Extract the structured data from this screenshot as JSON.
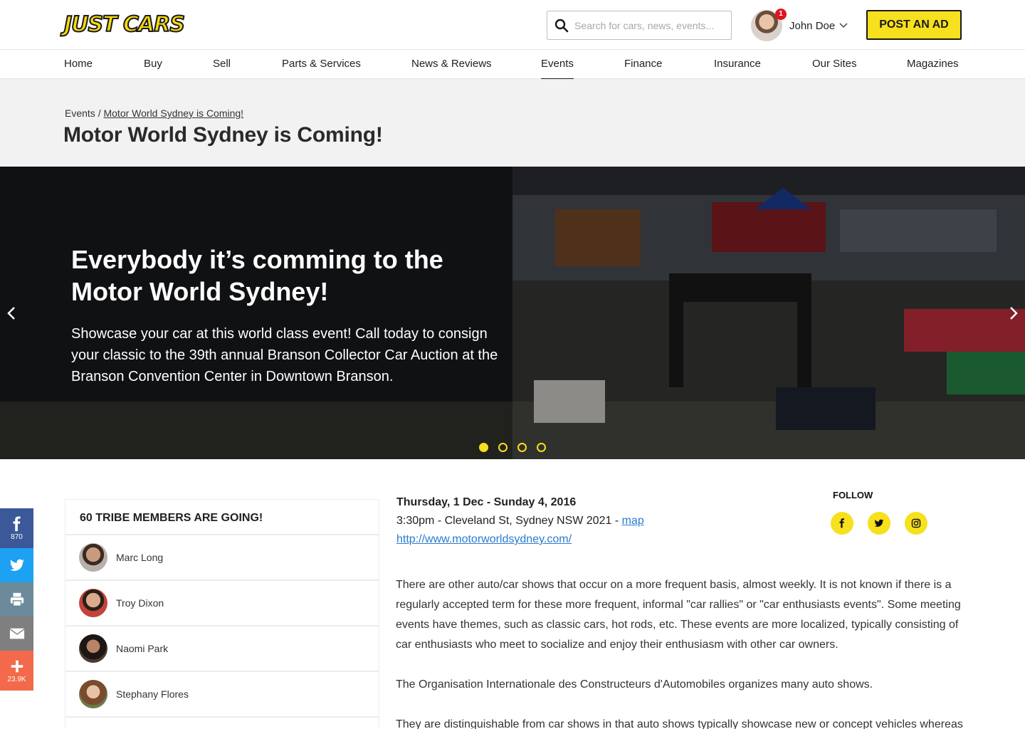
{
  "header": {
    "logo_text": "JUST CARS",
    "search_placeholder": "Search for cars, news, events...",
    "user_name": "John Doe",
    "notification_count": "1",
    "post_button": "POST AN AD"
  },
  "nav": {
    "items": [
      "Home",
      "Buy",
      "Sell",
      "Parts & Services",
      "News & Reviews",
      "Events",
      "Finance",
      "Insurance",
      "Our Sites",
      "Magazines"
    ],
    "active": "Events"
  },
  "breadcrumb": {
    "parent": "Events",
    "separator": "/",
    "current": "Motor World Sydney is Coming!"
  },
  "page_title": "Motor World Sydney is Coming!",
  "hero": {
    "title": "Everybody it’s comming to the Motor World Sydney!",
    "description": "Showcase your car at this world class event! Call today to consign your classic to the 39th annual Branson Collector Car Auction at the Branson Convention Center in Downtown Branson.",
    "slide_count": 4,
    "active_slide": 1
  },
  "share": {
    "facebook_count": "870",
    "more_count": "23.9K",
    "colors": {
      "facebook": "#3b5998",
      "twitter": "#1da1f2",
      "print": "#6c8a9a",
      "email": "#7f7f7f",
      "more": "#f26a4b"
    }
  },
  "members": {
    "heading": "60 TRIBE MEMBERS ARE GOING!",
    "list": [
      "Marc Long",
      "Troy Dixon",
      "Naomi Park",
      "Stephany Flores"
    ]
  },
  "event": {
    "date": "Thursday, 1 Dec - Sunday 4, 2016",
    "location": "3:30pm - Cleveland St, Sydney NSW 2021 - ",
    "map_link": "map",
    "url": "http://www.motorworldsydney.com/"
  },
  "follow": {
    "label": "FOLLOW",
    "icons": [
      "facebook-icon",
      "twitter-icon",
      "instagram-icon"
    ]
  },
  "article": {
    "paragraphs": [
      "There are other auto/car shows that occur on a more frequent basis, almost weekly. It is not known if there is a regularly accepted term for these more frequent, informal \"car rallies\" or \"car enthusiasts events\". Some meeting events have themes, such as classic cars, hot rods, etc. These events are more localized, typically consisting of car enthusiasts who meet to socialize and enjoy their enthusiasm with other car owners.",
      "The Organisation Internationale des Constructeurs d'Automobiles organizes many auto shows.",
      "They are distinguishable from car shows in that auto shows typically showcase new or concept vehicles whereas"
    ]
  },
  "colors": {
    "brand_yellow": "#f7e01d",
    "link_blue": "#2a7ad0"
  }
}
